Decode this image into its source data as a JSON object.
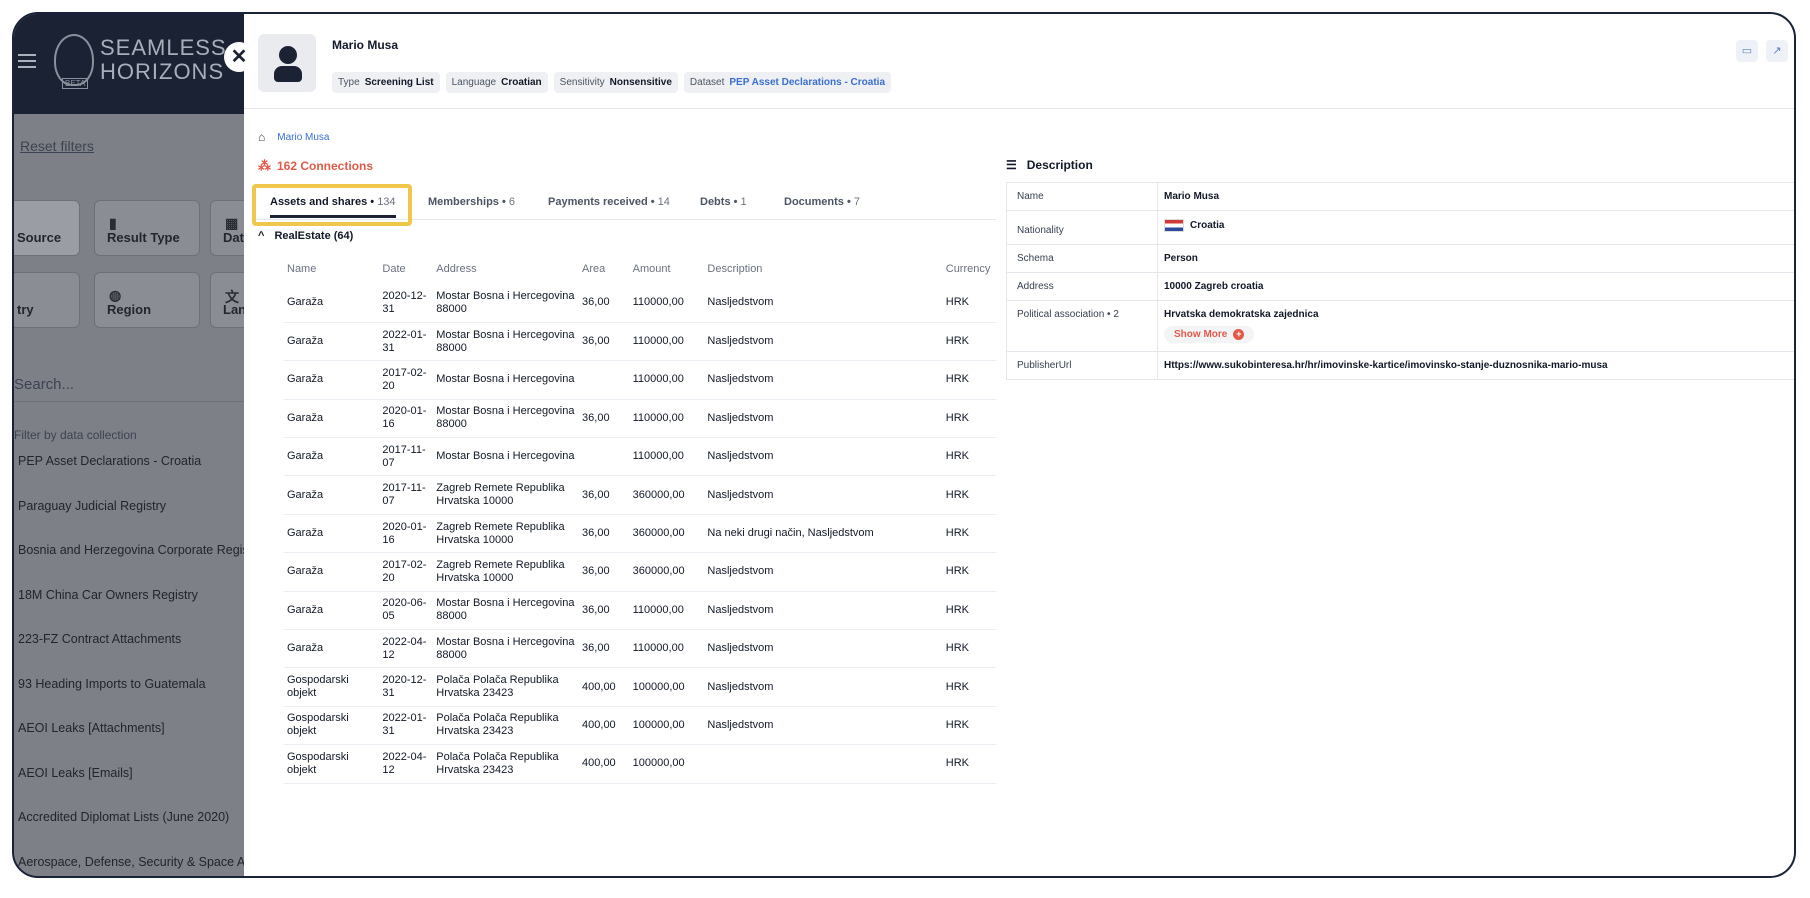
{
  "background": {
    "logo_line1": "SEAMLESS",
    "logo_line2": "HORIZONS",
    "logo_badge": "BETA",
    "reset_filters": "Reset filters",
    "cards": [
      "Source",
      "Result Type",
      "Data",
      "try",
      "Region",
      "Lan"
    ],
    "search_placeholder": "Search...",
    "filter_label": "Filter by data collection",
    "collections": [
      "PEP Asset Declarations - Croatia",
      "Paraguay Judicial Registry",
      "Bosnia and Herzegovina Corporate Registry",
      "18M China Car Owners Registry",
      "223-FZ Contract Attachments",
      "93 Heading Imports to Guatemala",
      "AEOI Leaks [Attachments]",
      "AEOI Leaks [Emails]",
      "Accredited Diplomat Lists (June 2020)",
      "Aerospace, Defense, Security & Space Assets"
    ]
  },
  "entity": {
    "name": "Mario Musa",
    "tags": {
      "type_label": "Type",
      "type_value": "Screening List",
      "language_label": "Language",
      "language_value": "Croatian",
      "sensitivity_label": "Sensitivity",
      "sensitivity_value": "Nonsensitive",
      "dataset_label": "Dataset",
      "dataset_value": "PEP Asset Declarations - Croatia"
    }
  },
  "breadcrumb": {
    "current": "Mario Musa"
  },
  "connections": "162 Connections",
  "tabs": [
    {
      "label": "Assets and shares",
      "count": "134"
    },
    {
      "label": "Memberships",
      "count": "6"
    },
    {
      "label": "Payments received",
      "count": "14"
    },
    {
      "label": "Debts",
      "count": "1"
    },
    {
      "label": "Documents",
      "count": "7"
    }
  ],
  "section_title": "RealEstate (64)",
  "table": {
    "headers": [
      "Name",
      "Date",
      "Address",
      "Area",
      "Amount",
      "Description",
      "Currency"
    ],
    "rows": [
      [
        "Garaža",
        "2020-12-31",
        "Mostar Bosna i Hercegovina 88000",
        "36,00",
        "110000,00",
        "Nasljedstvom",
        "HRK"
      ],
      [
        "Garaža",
        "2022-01-31",
        "Mostar Bosna i Hercegovina 88000",
        "36,00",
        "110000,00",
        "Nasljedstvom",
        "HRK"
      ],
      [
        "Garaža",
        "2017-02-20",
        "Mostar Bosna i Hercegovina",
        "",
        "110000,00",
        "Nasljedstvom",
        "HRK"
      ],
      [
        "Garaža",
        "2020-01-16",
        "Mostar Bosna i Hercegovina 88000",
        "36,00",
        "110000,00",
        "Nasljedstvom",
        "HRK"
      ],
      [
        "Garaža",
        "2017-11-07",
        "Mostar Bosna i Hercegovina",
        "",
        "110000,00",
        "Nasljedstvom",
        "HRK"
      ],
      [
        "Garaža",
        "2017-11-07",
        "Zagreb Remete Republika Hrvatska 10000",
        "36,00",
        "360000,00",
        "Nasljedstvom",
        "HRK"
      ],
      [
        "Garaža",
        "2020-01-16",
        "Zagreb Remete Republika Hrvatska 10000",
        "36,00",
        "360000,00",
        "Na neki drugi način, Nasljedstvom",
        "HRK"
      ],
      [
        "Garaža",
        "2017-02-20",
        "Zagreb Remete Republika Hrvatska 10000",
        "36,00",
        "360000,00",
        "Nasljedstvom",
        "HRK"
      ],
      [
        "Garaža",
        "2020-06-05",
        "Mostar Bosna i Hercegovina 88000",
        "36,00",
        "110000,00",
        "Nasljedstvom",
        "HRK"
      ],
      [
        "Garaža",
        "2022-04-12",
        "Mostar Bosna i Hercegovina 88000",
        "36,00",
        "110000,00",
        "Nasljedstvom",
        "HRK"
      ],
      [
        "Gospodarski objekt",
        "2020-12-31",
        "Polača Polača Republika Hrvatska 23423",
        "400,00",
        "100000,00",
        "Nasljedstvom",
        "HRK"
      ],
      [
        "Gospodarski objekt",
        "2022-01-31",
        "Polača Polača Republika Hrvatska 23423",
        "400,00",
        "100000,00",
        "Nasljedstvom",
        "HRK"
      ],
      [
        "Gospodarski objekt",
        "2022-04-12",
        "Polača Polača Republika Hrvatska 23423",
        "400,00",
        "100000,00",
        "",
        "HRK"
      ]
    ]
  },
  "description": {
    "title": "Description",
    "rows": [
      {
        "key": "Name",
        "value": "Mario Musa"
      },
      {
        "key": "Nationality",
        "value": "Croatia"
      },
      {
        "key": "Schema",
        "value": "Person"
      },
      {
        "key": "Address",
        "value": "10000 Zagreb croatia"
      },
      {
        "key": "Political association • 2",
        "value": "Hrvatska demokratska zajednica"
      },
      {
        "key": "PublisherUrl",
        "value": "Https://www.sukobinteresa.hr/hr/imovinske-kartice/imovinsko-stanje-duznosnika-mario-musa"
      }
    ],
    "show_more": "Show More"
  }
}
